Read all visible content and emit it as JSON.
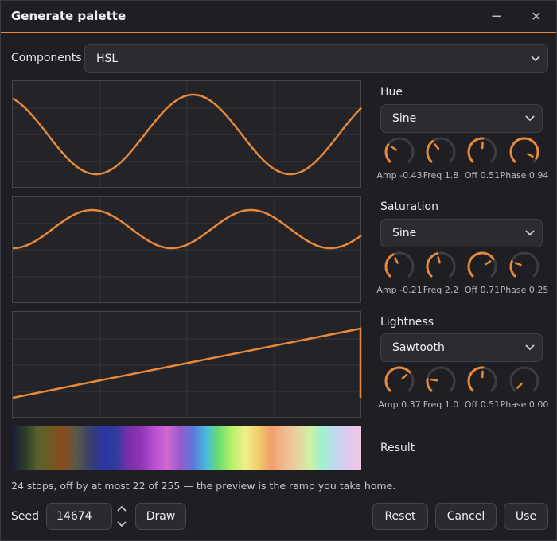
{
  "window": {
    "title": "Generate palette",
    "minimize_glyph": "−",
    "close_glyph": "✕"
  },
  "components": {
    "label": "Components",
    "value": "HSL"
  },
  "channels": [
    {
      "name": "Hue",
      "wave": "Sine",
      "knobs": [
        {
          "label": "Amp -0.43",
          "value": 0.29
        },
        {
          "label": "Freq 1.8",
          "value": 0.36
        },
        {
          "label": "Off 0.51",
          "value": 0.51
        },
        {
          "label": "Phase 0.94",
          "value": 0.94
        }
      ]
    },
    {
      "name": "Saturation",
      "wave": "Sine",
      "knobs": [
        {
          "label": "Amp -0.21",
          "value": 0.4
        },
        {
          "label": "Freq 2.2",
          "value": 0.44
        },
        {
          "label": "Off 0.71",
          "value": 0.71
        },
        {
          "label": "Phase 0.25",
          "value": 0.25
        }
      ]
    },
    {
      "name": "Lightness",
      "wave": "Sawtooth",
      "knobs": [
        {
          "label": "Amp 0.37",
          "value": 0.68
        },
        {
          "label": "Freq 1.0",
          "value": 0.2
        },
        {
          "label": "Off 0.51",
          "value": 0.51
        },
        {
          "label": "Phase 0.00",
          "value": 0.0
        }
      ]
    }
  ],
  "result_label": "Result",
  "status": "24 stops, off by at most 22 of 255 — the preview is the ramp you take home.",
  "seed": {
    "label": "Seed",
    "value": "14674"
  },
  "buttons": {
    "draw": "Draw",
    "reset": "Reset",
    "cancel": "Cancel",
    "use": "Use"
  },
  "colors": {
    "accent": "#e8893a",
    "track": "#3c3c42",
    "panel": "#232328"
  },
  "ramp_colors": [
    "#1b1f33",
    "#2b3a2a",
    "#59612c",
    "#6e5a22",
    "#8a4a1c",
    "#5a5a4a",
    "#3b3f6a",
    "#2a36a0",
    "#303b9e",
    "#7a2ea8",
    "#8f36b4",
    "#b84fd0",
    "#d06ad2",
    "#9a5ad0",
    "#5a7ad8",
    "#4ab8e0",
    "#6ae06a",
    "#b8f06a",
    "#f0f08a",
    "#f0d06a",
    "#f0a06a",
    "#f2b890",
    "#e8d0a0",
    "#d0f0a0",
    "#a0f0d0",
    "#c0d8f0",
    "#e0c8f0",
    "#f0c8e0"
  ]
}
